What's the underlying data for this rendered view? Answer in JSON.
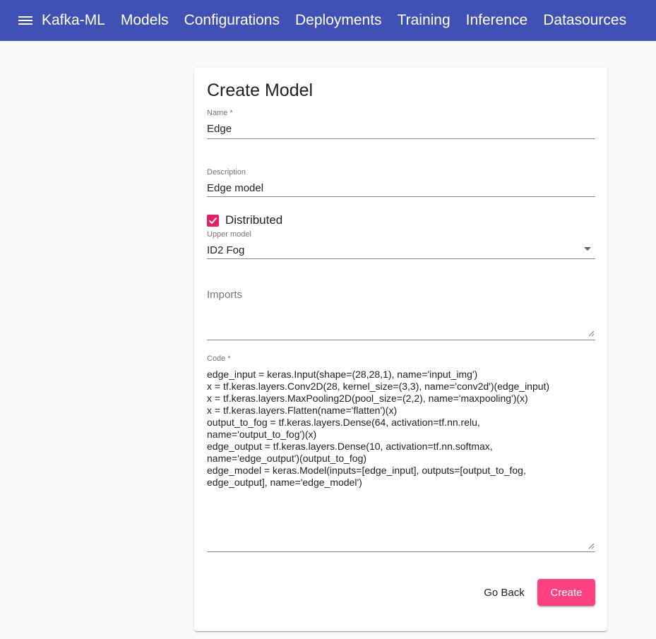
{
  "navbar": {
    "brand": "Kafka-ML",
    "links": [
      "Models",
      "Configurations",
      "Deployments",
      "Training",
      "Inference",
      "Datasources"
    ]
  },
  "form": {
    "title": "Create Model",
    "name": {
      "label": "Name *",
      "value": "Edge"
    },
    "description": {
      "label": "Description",
      "value": "Edge model"
    },
    "distributed": {
      "label": "Distributed",
      "checked": true
    },
    "upper_model": {
      "label": "Upper model",
      "value": "ID2 Fog"
    },
    "imports": {
      "placeholder": "Imports",
      "value": ""
    },
    "code": {
      "label": "Code *",
      "lines": [
        "edge_input = keras.Input(shape=(28,28,1), name='input_img')",
        "x = tf.keras.layers.Conv2D(28, kernel_size=(3,3), name='conv2d')(edge_input)",
        "x = tf.keras.layers.MaxPooling2D(pool_size=(2,2), name='maxpooling')(x)",
        "x = tf.keras.layers.Flatten(name='flatten')(x)",
        "output_to_fog = tf.keras.layers.Dense(64, activation=tf.nn.relu,",
        "name='output_to_fog')(x)",
        "edge_output = tf.keras.layers.Dense(10, activation=tf.nn.softmax,",
        "name='edge_output')(output_to_fog)",
        "edge_model = keras.Model(inputs=[edge_input], outputs=[output_to_fog,",
        "edge_output], name='edge_model')"
      ]
    },
    "buttons": {
      "back": "Go Back",
      "create": "Create"
    }
  },
  "colors": {
    "primary": "#3f51b5",
    "accent": "#ff4081",
    "checkbox": "#e91e63"
  },
  "icons": {
    "menu": "menu-icon",
    "check": "check-icon",
    "dropdown": "dropdown-arrow-icon",
    "resize": "resize-handle-icon"
  }
}
